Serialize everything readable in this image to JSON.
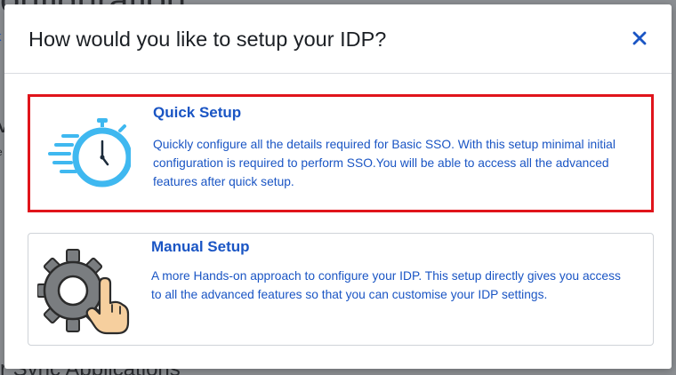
{
  "modal": {
    "title": "How would you like to setup your IDP?",
    "close_icon": "close-icon",
    "accent_color": "#1a55c4",
    "options": [
      {
        "title": "Quick Setup",
        "description": "Quickly configure all the details required for Basic SSO. With this setup minimal initial configuration is required to perform SSO.You will be able to access all the advanced features after quick setup.",
        "icon": "stopwatch-icon",
        "selected": true
      },
      {
        "title": "Manual Setup",
        "description": "A more Hands-on approach to configure your IDP. This setup directly gives you access to all the advanced features so that you can customise your IDP settings.",
        "icon": "gear-hand-icon",
        "selected": false
      }
    ]
  },
  "background": {
    "title": "onfiguration",
    "link": "k",
    "letter": "V",
    "small_text": "e",
    "bottom_text": "r Sync Applications"
  }
}
